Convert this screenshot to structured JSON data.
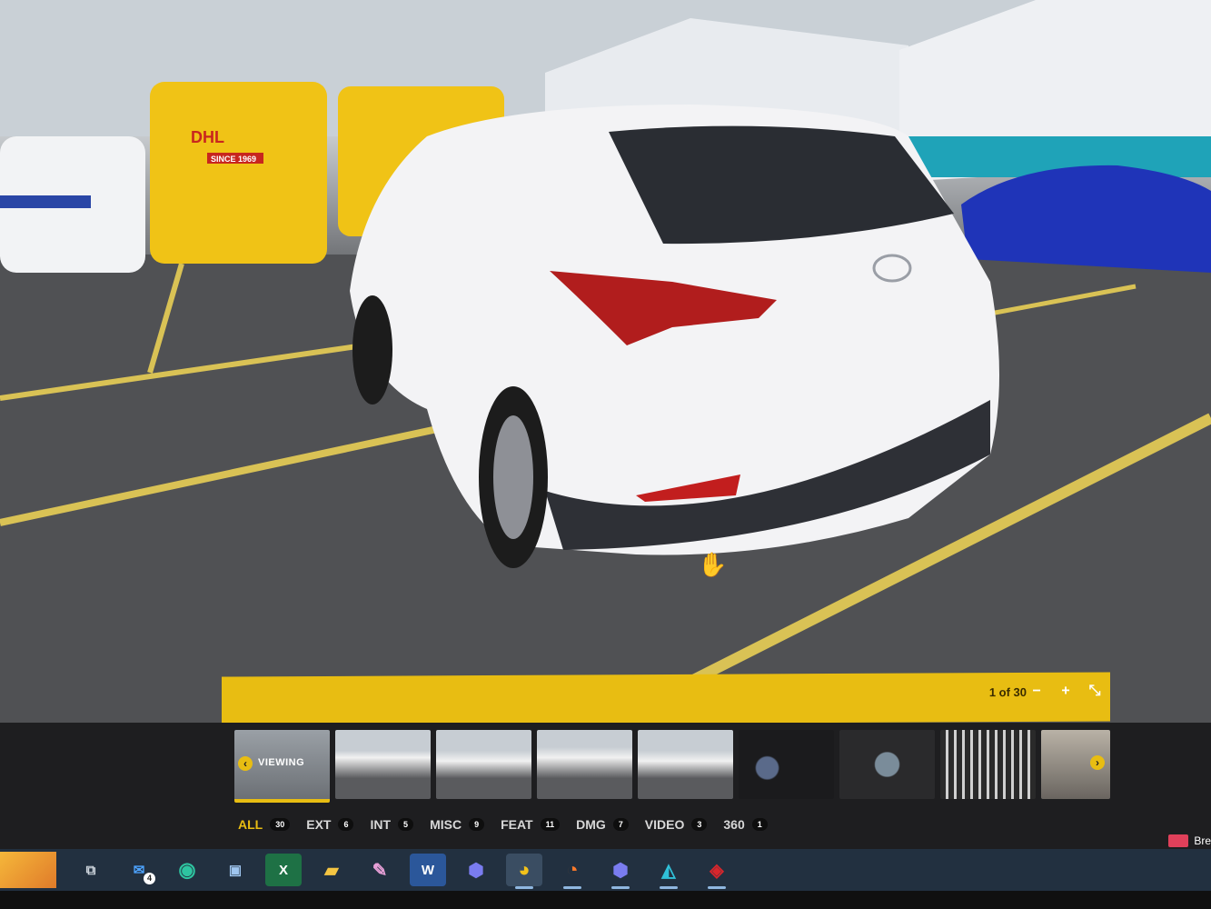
{
  "viewer": {
    "counter": "1 of 30",
    "zoom_out_label": "−",
    "zoom_in_label": "+",
    "fullscreen_label": "⤡"
  },
  "thumbnails": [
    {
      "label": "VIEWING",
      "active": true
    },
    {
      "label": ""
    },
    {
      "label": ""
    },
    {
      "label": ""
    },
    {
      "label": ""
    },
    {
      "label": ""
    },
    {
      "label": ""
    },
    {
      "label": ""
    },
    {
      "label": ""
    }
  ],
  "filters": [
    {
      "name": "ALL",
      "count": "30",
      "active": true
    },
    {
      "name": "EXT",
      "count": "6"
    },
    {
      "name": "INT",
      "count": "5"
    },
    {
      "name": "MISC",
      "count": "9"
    },
    {
      "name": "FEAT",
      "count": "11"
    },
    {
      "name": "DMG",
      "count": "7"
    },
    {
      "name": "VIDEO",
      "count": "3"
    },
    {
      "name": "360",
      "count": "1"
    }
  ],
  "photo_text": {
    "van_logo": "DHL",
    "van_since": "SINCE 1969"
  },
  "taskbar": {
    "mail_badge": "4",
    "tray_text": "Bre"
  },
  "colors": {
    "accent": "#e8bd12",
    "panel": "#1e1e20",
    "taskbar": "#223040"
  }
}
